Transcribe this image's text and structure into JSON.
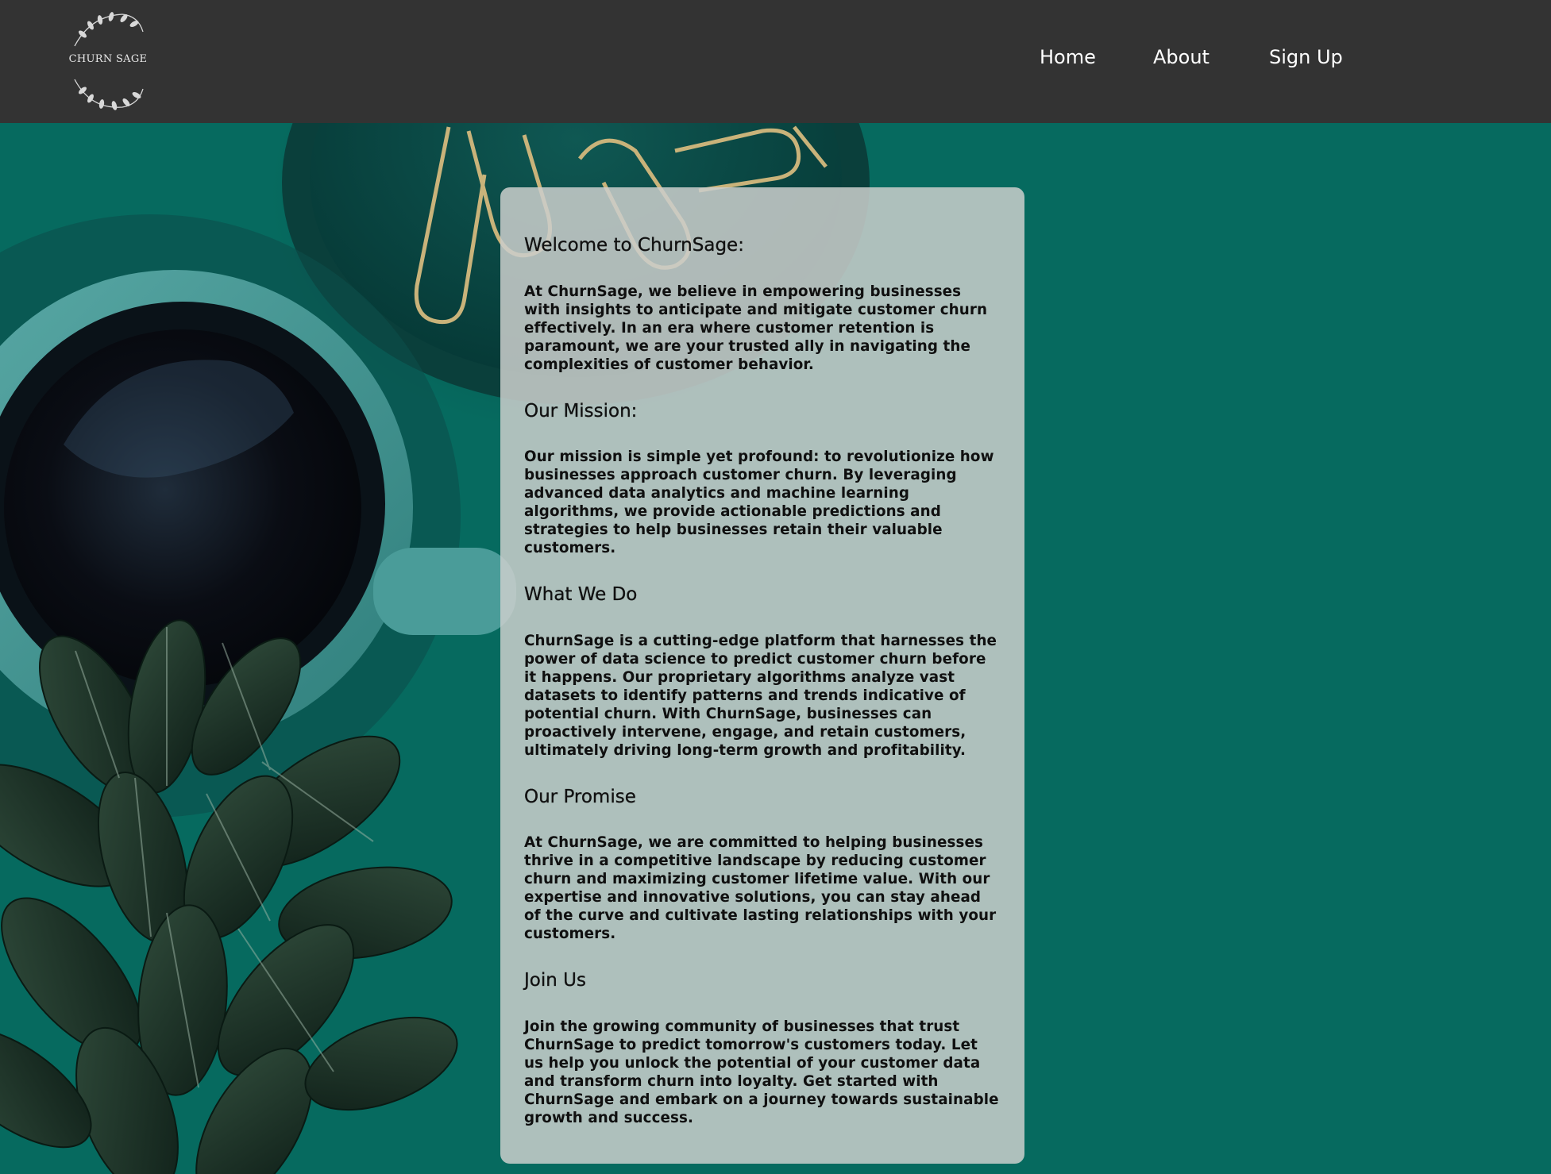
{
  "header": {
    "logo_text": "CHURN SAGE",
    "nav": [
      {
        "label": "Home"
      },
      {
        "label": "About"
      },
      {
        "label": "Sign Up"
      }
    ]
  },
  "sections": [
    {
      "heading": "Welcome to ChurnSage:",
      "body": "At ChurnSage, we believe in empowering businesses with insights to anticipate and mitigate customer churn effectively. In an era where customer retention is paramount, we are your trusted ally in navigating the complexities of customer behavior."
    },
    {
      "heading": "Our Mission:",
      "body": "Our mission is simple yet profound: to revolutionize how businesses approach customer churn. By leveraging advanced data analytics and machine learning algorithms, we provide actionable predictions and strategies to help businesses retain their valuable customers."
    },
    {
      "heading": "What We Do",
      "body": "ChurnSage is a cutting-edge platform that harnesses the power of data science to predict customer churn before it happens. Our proprietary algorithms analyze vast datasets to identify patterns and trends indicative of potential churn. With ChurnSage, businesses can proactively intervene, engage, and retain customers, ultimately driving long-term growth and profitability."
    },
    {
      "heading": "Our Promise",
      "body": "At ChurnSage, we are committed to helping businesses thrive in a competitive landscape by reducing customer churn and maximizing customer lifetime value. With our expertise and innovative solutions, you can stay ahead of the curve and cultivate lasting relationships with your customers."
    },
    {
      "heading": "Join Us",
      "body": "Join the growing community of businesses that trust ChurnSage to predict tomorrow's customers today. Let us help you unlock the potential of your customer data and transform churn into loyalty. Get started with ChurnSage and embark on a journey towards sustainable growth and success."
    }
  ],
  "colors": {
    "header_bg": "#333333",
    "page_bg": "#066a5f",
    "card_bg": "#cbcecc",
    "nav_text": "#ffffff"
  },
  "icons": {
    "logo": "laurel-wreath-icon",
    "background": "coffee-mug-plant-paperclips-photo"
  }
}
